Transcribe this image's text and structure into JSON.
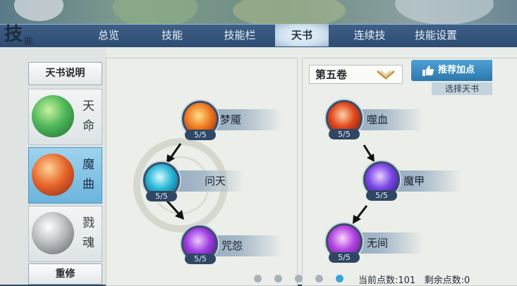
{
  "header": {
    "title_char_1": "技",
    "title_char_2": "能"
  },
  "tabs": [
    {
      "label": "总览",
      "active": false
    },
    {
      "label": "技能",
      "active": false
    },
    {
      "label": "技能栏",
      "active": false
    },
    {
      "label": "天书",
      "active": true
    },
    {
      "label": "连续技",
      "active": false
    },
    {
      "label": "技能设置",
      "active": false
    }
  ],
  "sidebar": {
    "explain_label": "天书说明",
    "books": [
      {
        "label": "天命",
        "active": false,
        "icon": "jade-beast-icon"
      },
      {
        "label": "魔曲",
        "active": true,
        "icon": "flame-beast-icon"
      },
      {
        "label": "戮魂",
        "active": false,
        "icon": "silver-beast-icon"
      }
    ],
    "reset_label": "重修"
  },
  "left_tree": {
    "skills": [
      {
        "name": "梦魇",
        "level": "5/5",
        "icon": "fire-fist-icon"
      },
      {
        "name": "问天",
        "level": "5/5",
        "icon": "lightning-icon"
      },
      {
        "name": "咒怨",
        "level": "5/5",
        "icon": "purple-vortex-icon"
      }
    ]
  },
  "right_tree": {
    "volume_label": "第五卷",
    "recommend_label": "推荐加点",
    "choose_label": "选择天书",
    "skills": [
      {
        "name": "噬血",
        "level": "5/5",
        "icon": "blood-figure-icon"
      },
      {
        "name": "魔甲",
        "level": "5/5",
        "icon": "magic-armor-icon"
      },
      {
        "name": "无间",
        "level": "5/5",
        "icon": "purple-figure-icon"
      }
    ]
  },
  "footer": {
    "current_points_label": "当前点数:",
    "current_points": "101",
    "remaining_points_label": "剩余点数:",
    "remaining_points": "0",
    "page_count": 5,
    "active_page": 5
  }
}
